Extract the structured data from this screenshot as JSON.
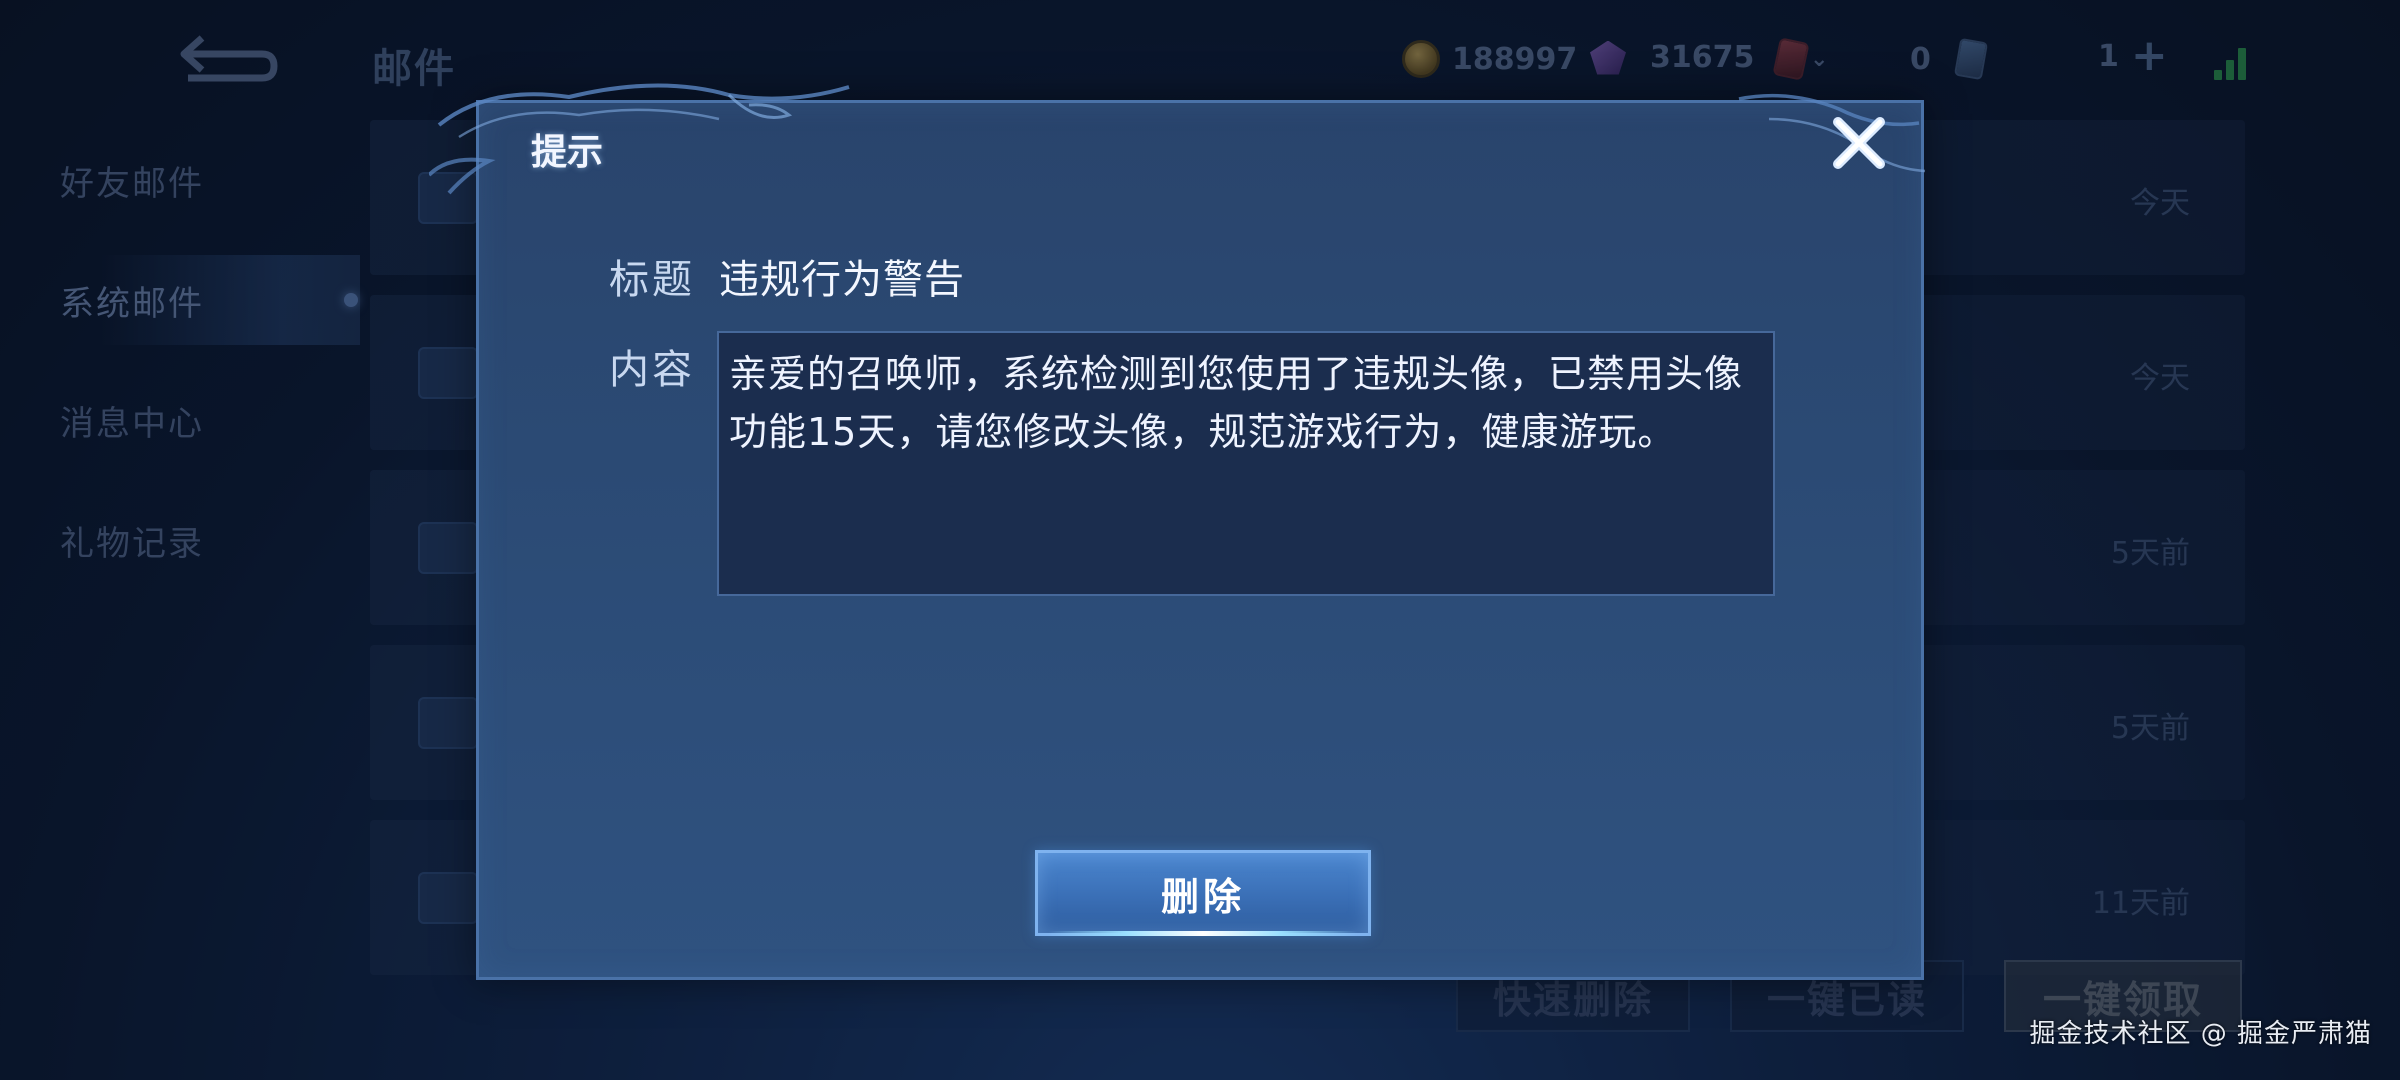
{
  "header": {
    "title": "邮件",
    "gold": "188997",
    "diamond": "31675",
    "tickets": "0",
    "level_badge": "1"
  },
  "sidebar": {
    "items": [
      {
        "label": "好友邮件"
      },
      {
        "label": "系统邮件"
      },
      {
        "label": "消息中心"
      },
      {
        "label": "礼物记录"
      }
    ],
    "active_index": 1
  },
  "mail_list": {
    "times": [
      "今天",
      "今天",
      "5天前",
      "5天前",
      "11天前"
    ]
  },
  "actions": {
    "quick_delete": "快速删除",
    "mark_all_read": "一键已读",
    "claim_all": "一键领取"
  },
  "dialog": {
    "title": "提示",
    "subject_label": "标题",
    "subject_value": "违规行为警告",
    "content_label": "内容",
    "content_value": "亲爱的召唤师，系统检测到您使用了违规头像，已禁用头像功能15天，请您修改头像，规范游戏行为，健康游玩。",
    "delete_label": "删除",
    "close_icon": "close-icon"
  },
  "watermark": "掘金技术社区 @ 掘金严肃猫",
  "colors": {
    "dialog_bg": "#2b4a74",
    "dialog_border": "#4a72a8",
    "button_blue": "#3a6fb6",
    "signal_green": "#2a8f4c"
  }
}
